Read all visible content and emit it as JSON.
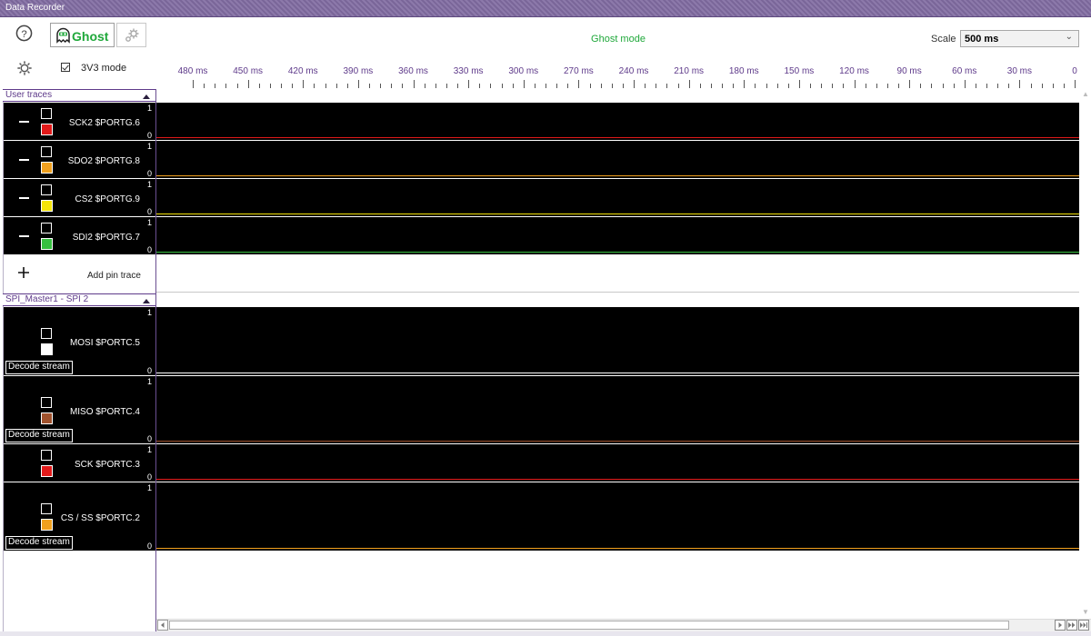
{
  "window": {
    "title": "Data Recorder"
  },
  "toolbar": {
    "ghost_label": "Ghost",
    "ghost_mode_text": "Ghost mode",
    "scale_label": "Scale",
    "scale_value": "500 ms",
    "v3_label": "3V3 mode",
    "v3_checked": true
  },
  "timeline": {
    "labels": [
      "480 ms",
      "450 ms",
      "420 ms",
      "390 ms",
      "360 ms",
      "330 ms",
      "300 ms",
      "270 ms",
      "240 ms",
      "210 ms",
      "180 ms",
      "150 ms",
      "120 ms",
      "90 ms",
      "60 ms",
      "30 ms",
      "0"
    ]
  },
  "groups": [
    {
      "title": "User traces",
      "traces": [
        {
          "name": "SCK2 $PORTG.6",
          "color": "#e21a1a",
          "max": "1",
          "min": "0",
          "removable": true,
          "decode": ""
        },
        {
          "name": "SDO2 $PORTG.8",
          "color": "#f0a01e",
          "max": "1",
          "min": "0",
          "removable": true,
          "decode": ""
        },
        {
          "name": "CS2 $PORTG.9",
          "color": "#f5e40a",
          "max": "1",
          "min": "0",
          "removable": true,
          "decode": ""
        },
        {
          "name": "SDI2 $PORTG.7",
          "color": "#37c040",
          "max": "1",
          "min": "0",
          "removable": true,
          "decode": ""
        }
      ],
      "add_label": "Add pin trace"
    },
    {
      "title": "SPI_Master1 - SPI 2",
      "traces": [
        {
          "name": "MOSI $PORTC.5",
          "color": "#ffffff",
          "max": "1",
          "min": "0",
          "removable": false,
          "decode": "Decode stream"
        },
        {
          "name": "MISO $PORTC.4",
          "color": "#a0522d",
          "max": "1",
          "min": "0",
          "removable": false,
          "decode": "Decode stream"
        },
        {
          "name": "SCK $PORTC.3",
          "color": "#e21a1a",
          "max": "1",
          "min": "0",
          "removable": false,
          "decode": ""
        },
        {
          "name": "CS / SS $PORTC.2",
          "color": "#f0a01e",
          "max": "1",
          "min": "0",
          "removable": false,
          "decode": "Decode stream"
        }
      ]
    }
  ]
}
